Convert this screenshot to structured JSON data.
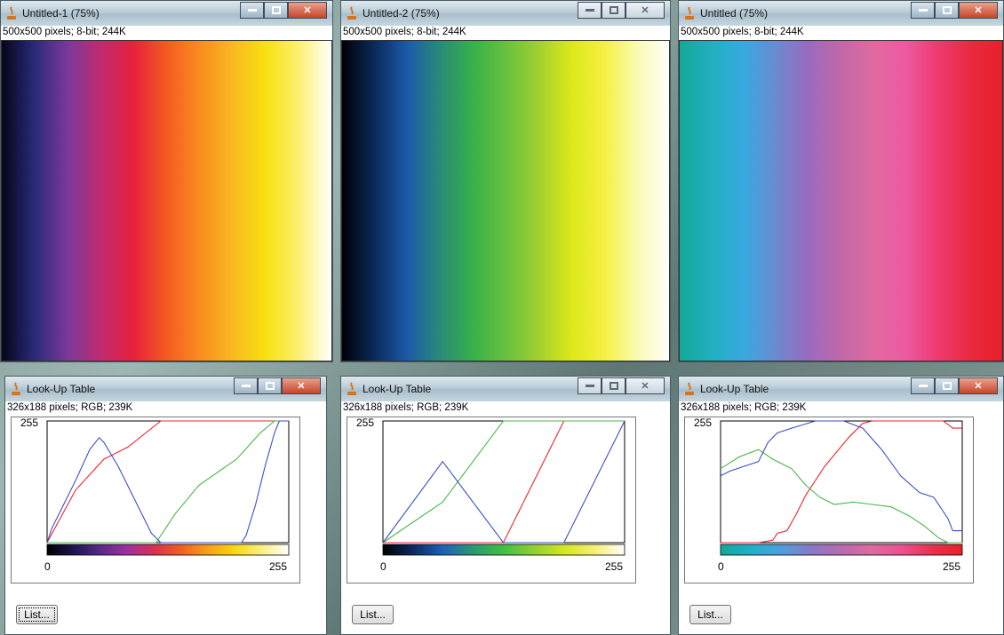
{
  "image_windows": [
    {
      "title": "Untitled-1 (75%)",
      "info": "500x500 pixels; 8-bit; 244K",
      "active": true,
      "gradient": [
        "#05051a",
        "#2a2a7a",
        "#7a3a9a",
        "#c02a70",
        "#e8203a",
        "#f45a20",
        "#f88c20",
        "#f8b820",
        "#f8e010",
        "#fcf070",
        "#ffffff"
      ]
    },
    {
      "title": "Untitled-2 (75%)",
      "info": "500x500 pixels; 8-bit; 244K",
      "active": false,
      "gradient": [
        "#000005",
        "#0a2a5a",
        "#1c5aa8",
        "#2a8a78",
        "#38b048",
        "#66c040",
        "#a0d030",
        "#dce818",
        "#f4f040",
        "#fafab0",
        "#ffffff"
      ]
    },
    {
      "title": "Untitled (75%)",
      "info": "500x500 pixels; 8-bit; 244K",
      "active": true,
      "gradient": [
        "#14a898",
        "#20b0c0",
        "#3aa8e0",
        "#6a8ad0",
        "#9a6ac0",
        "#c068a8",
        "#e06aa0",
        "#ec5aa0",
        "#ee3a70",
        "#ea2a40",
        "#e82028"
      ]
    }
  ],
  "lut_windows": [
    {
      "title": "Look-Up Table",
      "info": "326x188 pixels; RGB; 239K",
      "y_max_label": "255",
      "x_min_label": "0",
      "x_max_label": "255",
      "list_label": "List...",
      "list_focused": true,
      "active": true,
      "bar_gradient": [
        "#000000",
        "#1c1650",
        "#5a2a8a",
        "#a030a0",
        "#d83050",
        "#f06020",
        "#f8a018",
        "#f8d810",
        "#fcf080",
        "#ffffff"
      ],
      "curves": {
        "red": [
          [
            0,
            0
          ],
          [
            30,
            110
          ],
          [
            60,
            175
          ],
          [
            85,
            200
          ],
          [
            120,
            255
          ],
          [
            255,
            255
          ]
        ],
        "green": [
          [
            0,
            0
          ],
          [
            115,
            0
          ],
          [
            135,
            60
          ],
          [
            160,
            120
          ],
          [
            200,
            175
          ],
          [
            225,
            230
          ],
          [
            240,
            255
          ],
          [
            255,
            255
          ]
        ],
        "blue": [
          [
            0,
            0
          ],
          [
            5,
            30
          ],
          [
            15,
            70
          ],
          [
            30,
            130
          ],
          [
            45,
            195
          ],
          [
            55,
            220
          ],
          [
            60,
            210
          ],
          [
            75,
            160
          ],
          [
            95,
            80
          ],
          [
            110,
            20
          ],
          [
            120,
            0
          ],
          [
            205,
            0
          ],
          [
            210,
            15
          ],
          [
            220,
            80
          ],
          [
            230,
            160
          ],
          [
            240,
            230
          ],
          [
            245,
            255
          ],
          [
            255,
            255
          ]
        ]
      }
    },
    {
      "title": "Look-Up Table",
      "info": "326x188 pixels; RGB; 239K",
      "y_max_label": "255",
      "x_min_label": "0",
      "x_max_label": "255",
      "list_label": "List...",
      "list_focused": false,
      "active": false,
      "bar_gradient": [
        "#000000",
        "#0c2a60",
        "#1e60b8",
        "#2a9a70",
        "#40c040",
        "#90d030",
        "#d4e820",
        "#f4f070",
        "#ffffff"
      ],
      "curves": {
        "red": [
          [
            0,
            0
          ],
          [
            127,
            0
          ],
          [
            191,
            255
          ],
          [
            255,
            255
          ]
        ],
        "green": [
          [
            0,
            0
          ],
          [
            63,
            85
          ],
          [
            127,
            255
          ],
          [
            255,
            255
          ]
        ],
        "blue": [
          [
            0,
            0
          ],
          [
            63,
            170
          ],
          [
            127,
            0
          ],
          [
            191,
            0
          ],
          [
            255,
            255
          ]
        ]
      }
    },
    {
      "title": "Look-Up Table",
      "info": "326x188 pixels; RGB; 239K",
      "y_max_label": "255",
      "x_min_label": "0",
      "x_max_label": "255",
      "list_label": "List...",
      "list_focused": false,
      "active": true,
      "bar_gradient": [
        "#10a898",
        "#20b0c8",
        "#4aa0e0",
        "#8a78c8",
        "#b86ab0",
        "#e06aa0",
        "#ee5090",
        "#ea3050",
        "#e82028"
      ],
      "curves": {
        "red": [
          [
            0,
            0
          ],
          [
            40,
            0
          ],
          [
            55,
            5
          ],
          [
            60,
            20
          ],
          [
            70,
            25
          ],
          [
            80,
            60
          ],
          [
            90,
            100
          ],
          [
            110,
            160
          ],
          [
            135,
            220
          ],
          [
            150,
            250
          ],
          [
            160,
            255
          ],
          [
            235,
            255
          ],
          [
            245,
            240
          ],
          [
            255,
            240
          ]
        ],
        "green": [
          [
            0,
            155
          ],
          [
            20,
            180
          ],
          [
            40,
            195
          ],
          [
            55,
            175
          ],
          [
            75,
            155
          ],
          [
            90,
            120
          ],
          [
            105,
            95
          ],
          [
            120,
            80
          ],
          [
            140,
            85
          ],
          [
            160,
            80
          ],
          [
            180,
            75
          ],
          [
            200,
            55
          ],
          [
            215,
            35
          ],
          [
            230,
            10
          ],
          [
            240,
            0
          ],
          [
            255,
            0
          ]
        ],
        "blue": [
          [
            0,
            140
          ],
          [
            10,
            150
          ],
          [
            25,
            160
          ],
          [
            40,
            170
          ],
          [
            50,
            210
          ],
          [
            60,
            230
          ],
          [
            75,
            240
          ],
          [
            100,
            255
          ],
          [
            130,
            255
          ],
          [
            150,
            240
          ],
          [
            170,
            195
          ],
          [
            190,
            140
          ],
          [
            210,
            105
          ],
          [
            225,
            95
          ],
          [
            240,
            50
          ],
          [
            245,
            25
          ],
          [
            255,
            25
          ]
        ]
      }
    }
  ]
}
